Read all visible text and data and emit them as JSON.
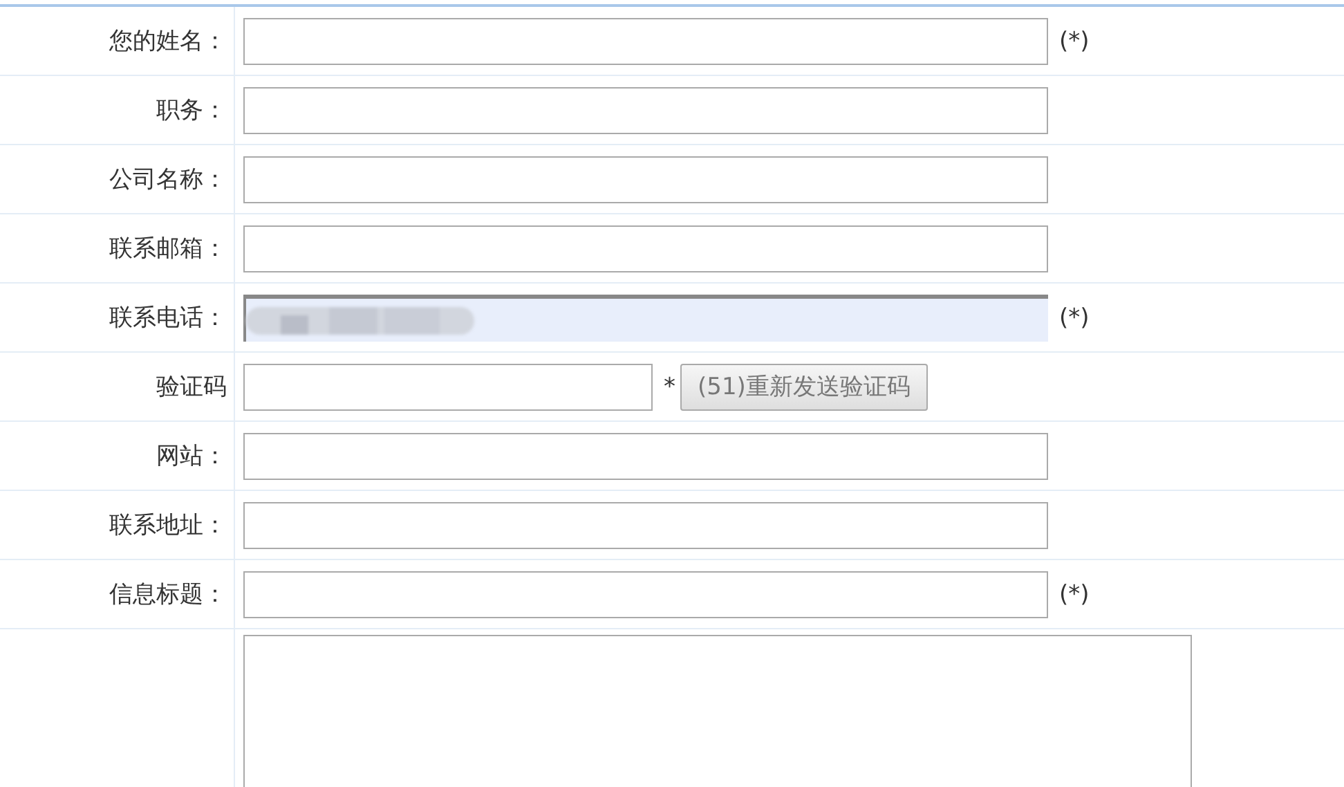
{
  "rows": [
    {
      "kind": "text",
      "label": "您的姓名：",
      "note": "(*)"
    },
    {
      "kind": "text",
      "label": "职务："
    },
    {
      "kind": "text",
      "label": "公司名称："
    },
    {
      "kind": "text",
      "label": "联系邮箱："
    },
    {
      "kind": "autofilled",
      "label": "联系电话：",
      "note": "(*)"
    },
    {
      "kind": "code",
      "label": "验证码",
      "note": "*",
      "button": "(51)重新发送验证码"
    },
    {
      "kind": "text",
      "label": "网站："
    },
    {
      "kind": "text",
      "label": "联系地址："
    },
    {
      "kind": "text",
      "label": "信息标题：",
      "note": "(*)"
    },
    {
      "kind": "textarea"
    }
  ]
}
